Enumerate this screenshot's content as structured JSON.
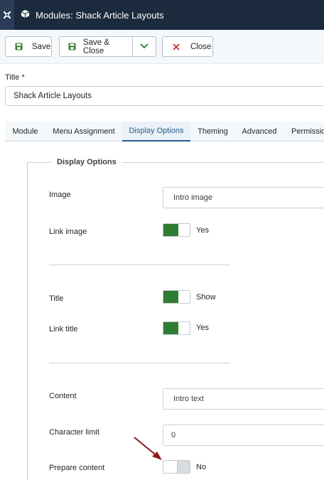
{
  "header": {
    "title": "Modules: Shack Article Layouts",
    "logo_icon": "joomla-logo-icon",
    "module_icon": "cube-icon"
  },
  "toolbar": {
    "save_label": "Save",
    "save_close_label": "Save & Close",
    "close_label": "Close",
    "save_icon": "floppy-disk-icon",
    "dropdown_icon": "chevron-down-icon",
    "close_icon": "x-icon",
    "save_color": "#2f7d32",
    "close_color": "#c52827"
  },
  "title_field": {
    "label": "Title *",
    "value": "Shack Article Layouts"
  },
  "tabs": [
    {
      "label": "Module",
      "active": false
    },
    {
      "label": "Menu Assignment",
      "active": false
    },
    {
      "label": "Display Options",
      "active": true
    },
    {
      "label": "Theming",
      "active": false
    },
    {
      "label": "Advanced",
      "active": false
    },
    {
      "label": "Permissio",
      "active": false
    }
  ],
  "fieldset": {
    "legend": "Display Options",
    "fields": {
      "image": {
        "label": "Image",
        "value": "Intro image"
      },
      "link_image": {
        "label": "Link image",
        "state": "Yes",
        "on": true
      },
      "title": {
        "label": "Title",
        "state": "Show",
        "on": true
      },
      "link_title": {
        "label": "Link title",
        "state": "Yes",
        "on": true
      },
      "content": {
        "label": "Content",
        "value": "Intro text"
      },
      "character_limit": {
        "label": "Character limit",
        "value": "0"
      },
      "prepare_content": {
        "label": "Prepare content",
        "state": "No",
        "on": false
      }
    }
  },
  "colors": {
    "topbar": "#1c2a3e",
    "toggle_on": "#2f7d32",
    "active_tab": "#2a5b8d",
    "annotation_arrow": "#8b1a1a"
  }
}
